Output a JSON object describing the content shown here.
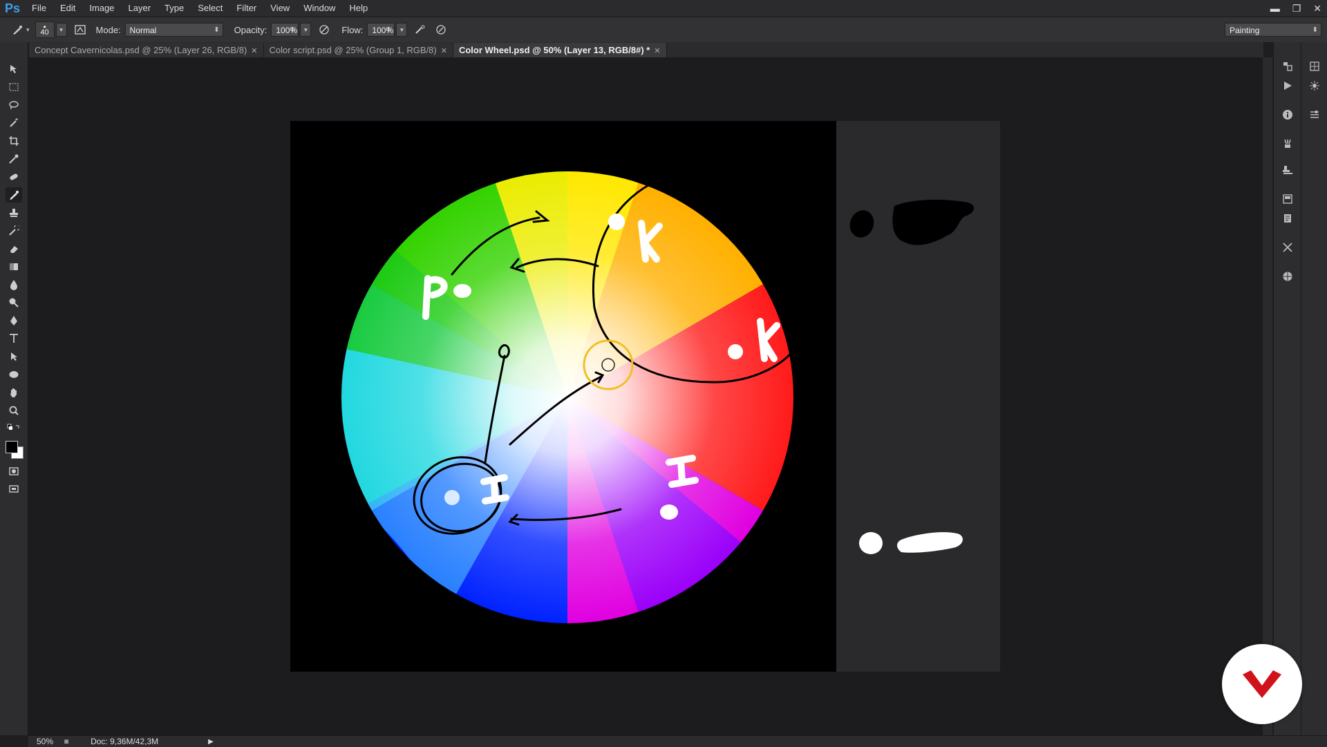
{
  "app": {
    "logo_text": "Ps",
    "menu": [
      "File",
      "Edit",
      "Image",
      "Layer",
      "Type",
      "Select",
      "Filter",
      "View",
      "Window",
      "Help"
    ],
    "window_controls": [
      "minimize",
      "restore",
      "close"
    ]
  },
  "options_bar": {
    "brush_size": "40",
    "mode_label": "Mode:",
    "mode_value": "Normal",
    "opacity_label": "Opacity:",
    "opacity_value": "100%",
    "flow_label": "Flow:",
    "flow_value": "100%",
    "workspace_value": "Painting"
  },
  "tabs": [
    {
      "label": "Concept Cavernicolas.psd @ 25% (Layer 26, RGB/8)",
      "active": false
    },
    {
      "label": "Color script.psd @ 25% (Group 1, RGB/8)",
      "active": false
    },
    {
      "label": "Color Wheel.psd @ 50% (Layer 13, RGB/8#) *",
      "active": true
    }
  ],
  "canvas": {
    "annotations": [
      "P",
      "K",
      "K",
      "I",
      "I"
    ]
  },
  "status": {
    "zoom": "50%",
    "doc": "Doc: 9,36M/42,3M"
  },
  "colors": {
    "ps_blue": "#3ea1e8",
    "badge_red": "#d0121b",
    "foreground": "#000000",
    "background": "#ffffff"
  }
}
